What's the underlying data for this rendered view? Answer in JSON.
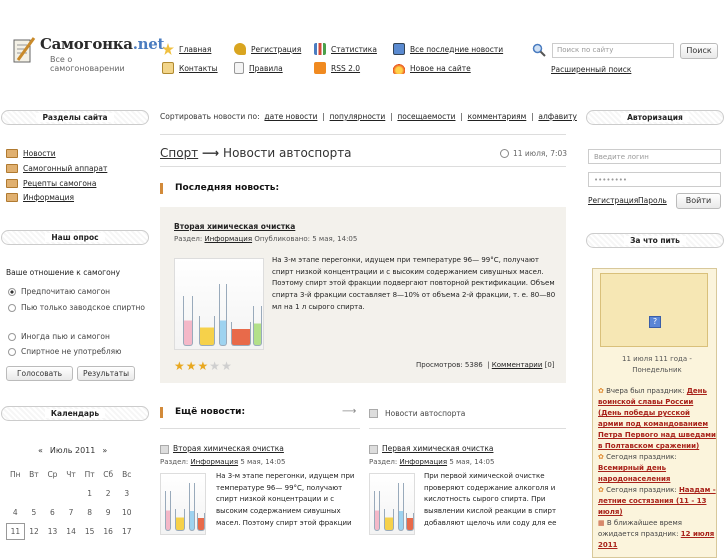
{
  "header": {
    "logo_title_main": "Самогонка",
    "logo_title_tld": ".net",
    "logo_subtitle": "Все о самогоноварении",
    "nav": [
      {
        "label": "Главная",
        "icon": "star-icon"
      },
      {
        "label": "Регистрация",
        "icon": "key-icon"
      },
      {
        "label": "Статистика",
        "icon": "bar-chart-icon"
      },
      {
        "label": "Все последние новости",
        "icon": "news-list-icon"
      },
      {
        "label": "Контакты",
        "icon": "mail-icon"
      },
      {
        "label": "Правила",
        "icon": "document-icon"
      },
      {
        "label": "RSS 2.0",
        "icon": "rss-icon"
      },
      {
        "label": "Новое на сайте",
        "icon": "fire-icon"
      }
    ],
    "search_placeholder": "Поиск по сайту",
    "search_button": "Поиск",
    "advanced_search": "Расширенный поиск"
  },
  "left": {
    "sections_title": "Разделы сайта",
    "menu": [
      "Новости",
      "Самогонный аппарат",
      "Рецепты самогона",
      "Информация"
    ],
    "poll_title": "Наш опрос",
    "poll_question": "Ваше отношение к самогону",
    "poll_options": [
      "Предпочитаю самогон",
      "Пью только заводское спиртно",
      "Иногда пью и самогон",
      "Спиртное не употребляю"
    ],
    "poll_vote": "Голосовать",
    "poll_results": "Результаты",
    "calendar_title": "Календарь",
    "calendar_month": "Июль 2011",
    "calendar_prev": "«",
    "calendar_next": "»",
    "weekdays": [
      "Пн",
      "Вт",
      "Ср",
      "Чт",
      "Пт",
      "Сб",
      "Вс"
    ],
    "weeks": [
      [
        "",
        "",
        "",
        "",
        "1",
        "2",
        "3"
      ],
      [
        "4",
        "5",
        "6",
        "7",
        "8",
        "9",
        "10"
      ],
      [
        "11",
        "12",
        "13",
        "14",
        "15",
        "16",
        "17"
      ]
    ]
  },
  "center": {
    "sort_label": "Сортировать новости по:",
    "sort_options": [
      "дате новости",
      "популярности",
      "посещаемости",
      "комментариям",
      "алфавиту"
    ],
    "breadcrumb_link": "Спорт",
    "breadcrumb_arrow": "⟶",
    "breadcrumb_current": "Новости автоспорта",
    "breadcrumb_date": "11 июля, 7:03",
    "last_news_header": "Последняя новость:",
    "last_news": {
      "title": "Вторая химическая очистка",
      "section_prefix": "Раздел:",
      "section": "Информация",
      "published": "Опубликовано: 5 мая, 14:05",
      "body_lines": [
        "На 3-м этапе перегонки, идущем при температуре 96— 99°С, получают",
        "спирт низкой концентрации и с высоким содержанием сивушных масел.",
        "Поэтому спирт этой фракции подвергают повторной ректификации. Объем",
        "спирта 3-й фракции составляет 8—10% от объема 2-й фракции, т. е. 80—80",
        "мл на 1 л сырого спирта."
      ],
      "rating": 3,
      "views": "Просмотров: 5386",
      "comments_label": "Комментарии",
      "comments_count": "[0]"
    },
    "more_news_header": "Ещё новости:",
    "more_news_arrow": "⟶",
    "more_news_category": "Новости автоспорта",
    "items": [
      {
        "title": "Вторая химическая очистка",
        "section_prefix": "Раздел:",
        "section": "Информация",
        "date": "5 мая, 14:05",
        "body_lines": [
          "На 3-м этапе перегонки, идущем при",
          "температуре 96— 99°С, получают",
          "спирт низкой концентрации и с",
          "высоким содержанием сивушных",
          "масел. Поэтому спирт этой фракции"
        ]
      },
      {
        "title": "Первая химическая очистка",
        "section_prefix": "Раздел:",
        "section": "Информация",
        "date": "5 мая, 14:05",
        "body_lines": [
          "При первой химической очистке",
          "проверяют содержание алкоголя и",
          "кислотность сырого спирта. При",
          "выявлении кислой реакции в спирт",
          "добавляют щелочь или соду для ее"
        ]
      }
    ]
  },
  "right": {
    "auth_title": "Авторизация",
    "login_placeholder": "Введите логин",
    "password_placeholder": "••••••••",
    "register_link": "Регистрация",
    "password_link": "Пароль",
    "login_button": "Войти",
    "drink_title": "За что пить",
    "holiday_date": "11 июля 111 года -",
    "holiday_weekday": "Понедельник",
    "holidays": [
      {
        "prefix": "Вчера был праздник:",
        "name": "День воинской славы России (День победы русской армии под командованием Петра Первого над шведами в Полтавском сражении)"
      },
      {
        "prefix": "Сегодня праздник:",
        "name": "Всемирный день народонаселения"
      },
      {
        "prefix": "Сегодня праздник:",
        "name": "Наадам - летние состязания (11 - 13 июля)"
      },
      {
        "prefix": "В ближайшее время ожидается праздник:",
        "name": "12 июля 2011"
      }
    ]
  },
  "colors": {
    "accent": "#d28a3a",
    "link": "#222222",
    "holiday_bg": "#fbf4dc",
    "holiday_red": "#a8221a"
  }
}
